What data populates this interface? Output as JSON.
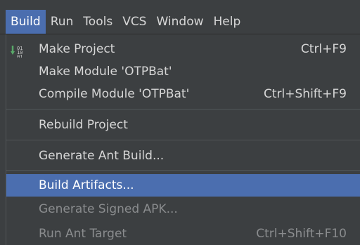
{
  "menubar": {
    "items": [
      {
        "label": "Build"
      },
      {
        "label": "Run"
      },
      {
        "label": "Tools"
      },
      {
        "label": "VCS"
      },
      {
        "label": "Window"
      },
      {
        "label": "Help"
      }
    ]
  },
  "build_menu": {
    "items": [
      {
        "label": "Make Project",
        "shortcut": "Ctrl+F9",
        "icon": "make-project-icon"
      },
      {
        "label": "Make Module 'OTPBat'",
        "shortcut": ""
      },
      {
        "label": "Compile Module 'OTPBat'",
        "shortcut": "Ctrl+Shift+F9"
      },
      {
        "label": "Rebuild Project",
        "shortcut": ""
      },
      {
        "label": "Generate Ant Build...",
        "shortcut": ""
      },
      {
        "label": "Build Artifacts...",
        "shortcut": "",
        "state": "selected"
      },
      {
        "label": "Generate Signed APK...",
        "shortcut": "",
        "state": "disabled"
      },
      {
        "label": "Run Ant Target",
        "shortcut": "Ctrl+Shift+F10",
        "state": "disabled"
      }
    ]
  },
  "colors": {
    "background": "#3c3f41",
    "selection": "#4b6eaf",
    "text": "#d6d6d6",
    "disabled_text": "#8a8c8e"
  }
}
